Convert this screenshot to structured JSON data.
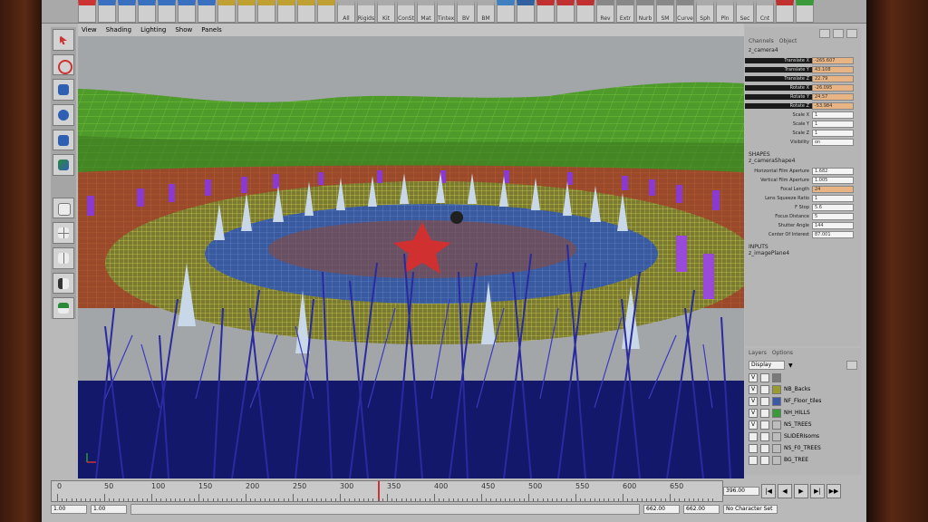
{
  "viewport_menu": {
    "items": [
      "View",
      "Shading",
      "Lighting",
      "Show",
      "Panels"
    ]
  },
  "shelf": {
    "labels": [
      "",
      "",
      "",
      "",
      "",
      "",
      "",
      "",
      "",
      "",
      "",
      "",
      "",
      "All",
      "Rigids",
      "Kit",
      "ConSt",
      "Mat",
      "Tintex",
      "BV",
      "BM",
      "",
      "",
      "",
      "",
      "",
      "Rev",
      "Extr",
      "Nurb",
      "SM",
      "Curve",
      "Sph",
      "Pln",
      "Sec",
      "Cnt",
      "",
      ""
    ]
  },
  "channel_box": {
    "tabs": [
      "Channels",
      "Object"
    ],
    "node_name": "z_camera4",
    "transform": [
      {
        "label": "Translate X",
        "value": "-265.607"
      },
      {
        "label": "Translate Y",
        "value": "43.108"
      },
      {
        "label": "Translate Z",
        "value": "22.79"
      },
      {
        "label": "Rotate X",
        "value": "-26.095"
      },
      {
        "label": "Rotate Y",
        "value": "24.57"
      },
      {
        "label": "Rotate Z",
        "value": "-53.984"
      },
      {
        "label": "Scale X",
        "value": "1"
      },
      {
        "label": "Scale Y",
        "value": "1"
      },
      {
        "label": "Scale Z",
        "value": "1"
      },
      {
        "label": "Visibility",
        "value": "on"
      }
    ],
    "shapes_header": "SHAPES",
    "shape_name": "z_cameraShape4",
    "shape": [
      {
        "label": "Horizontal Film Aperture",
        "value": "1.682",
        "keyed": false
      },
      {
        "label": "Vertical Film Aperture",
        "value": "1.005",
        "keyed": false
      },
      {
        "label": "Focal Length",
        "value": "24",
        "keyed": true
      },
      {
        "label": "Lens Squeeze Ratio",
        "value": "1",
        "keyed": false
      },
      {
        "label": "F Stop",
        "value": "5.6",
        "keyed": false
      },
      {
        "label": "Focus Distance",
        "value": "5",
        "keyed": false
      },
      {
        "label": "Shutter Angle",
        "value": "144",
        "keyed": false
      },
      {
        "label": "Center Of Interest",
        "value": "87.001",
        "keyed": false
      }
    ],
    "inputs_header": "INPUTS",
    "input_name": "z_imagePlane4"
  },
  "layers": {
    "tabs": [
      "Layers",
      "Options"
    ],
    "dropdown": "Display",
    "items": [
      {
        "name": "",
        "visible": true,
        "color": "#7a7a7a"
      },
      {
        "name": "NB_Backs",
        "visible": true,
        "color": "#9a9a30"
      },
      {
        "name": "NF_Floor_tiles",
        "visible": true,
        "color": "#3a5aa8"
      },
      {
        "name": "NH_HILLS",
        "visible": true,
        "color": "#3a9a3a"
      },
      {
        "name": "NS_TREES",
        "visible": true,
        "color": "#bdbdbd"
      },
      {
        "name": "SLIDERIsoms",
        "visible": false,
        "color": "#bdbdbd"
      },
      {
        "name": "NS_F0_TREES",
        "visible": false,
        "color": "#bdbdbd"
      },
      {
        "name": "BG_TREE",
        "visible": false,
        "color": "#bdbdbd"
      }
    ]
  },
  "timeline": {
    "ticks": [
      "0",
      "50",
      "100",
      "150",
      "200",
      "250",
      "300",
      "350",
      "400",
      "450",
      "500",
      "550",
      "600",
      "650"
    ],
    "current_frame": "396.00"
  },
  "range": {
    "start": "1.00",
    "inner_start": "1.00",
    "inner_end": "662.00",
    "end": "662.00",
    "character_set": "No Character Set"
  }
}
